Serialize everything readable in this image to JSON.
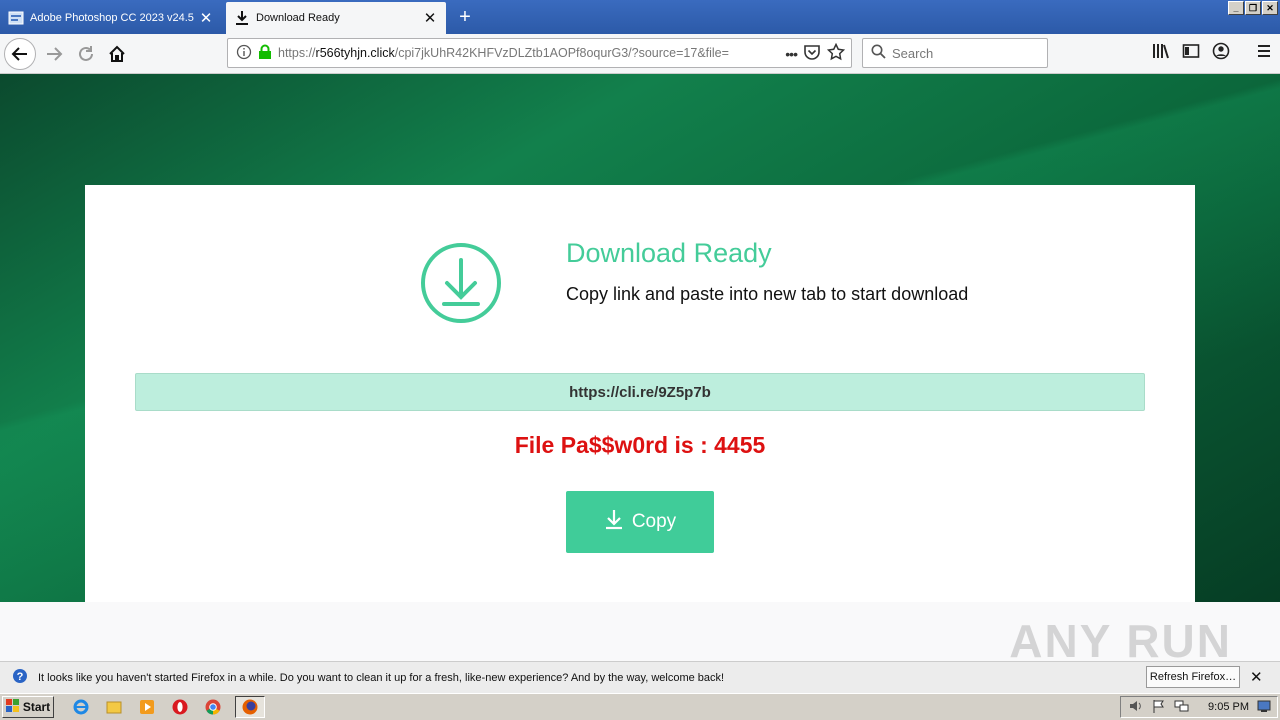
{
  "tabs": [
    {
      "title": "Adobe Photoshop CC 2023 v24.5",
      "active": false
    },
    {
      "title": "Download Ready",
      "active": true
    }
  ],
  "window_controls": {
    "minimize": "_",
    "restore": "❐",
    "close": "✕"
  },
  "navbar": {
    "url_scheme": "https://",
    "url_host": "r566tyhjn.click",
    "url_path": "/cpi7jkUhR42KHFVzDLZtb1AOPf8oqurG3/?source=17&file=",
    "page_actions": "•••",
    "search_placeholder": "Search"
  },
  "page": {
    "heading": "Download Ready",
    "subheading": "Copy link and paste into new tab to start download",
    "link": "https://cli.re/9Z5p7b",
    "password_text": "File Pa$$w0rd is : 4455",
    "copy_label": "Copy"
  },
  "watermark": "ANY RUN",
  "notification": {
    "message": "It looks like you haven't started Firefox in a while. Do you want to clean it up for a fresh, like-new experience? And by the way, welcome back!",
    "button": "Refresh Firefox…"
  },
  "taskbar": {
    "start_label": "Start",
    "clock": "9:05 PM"
  },
  "colors": {
    "accent_green": "#40cc99",
    "heading_green": "#44cc99",
    "link_box": "#bdeedd",
    "password_red": "#dd1111"
  }
}
